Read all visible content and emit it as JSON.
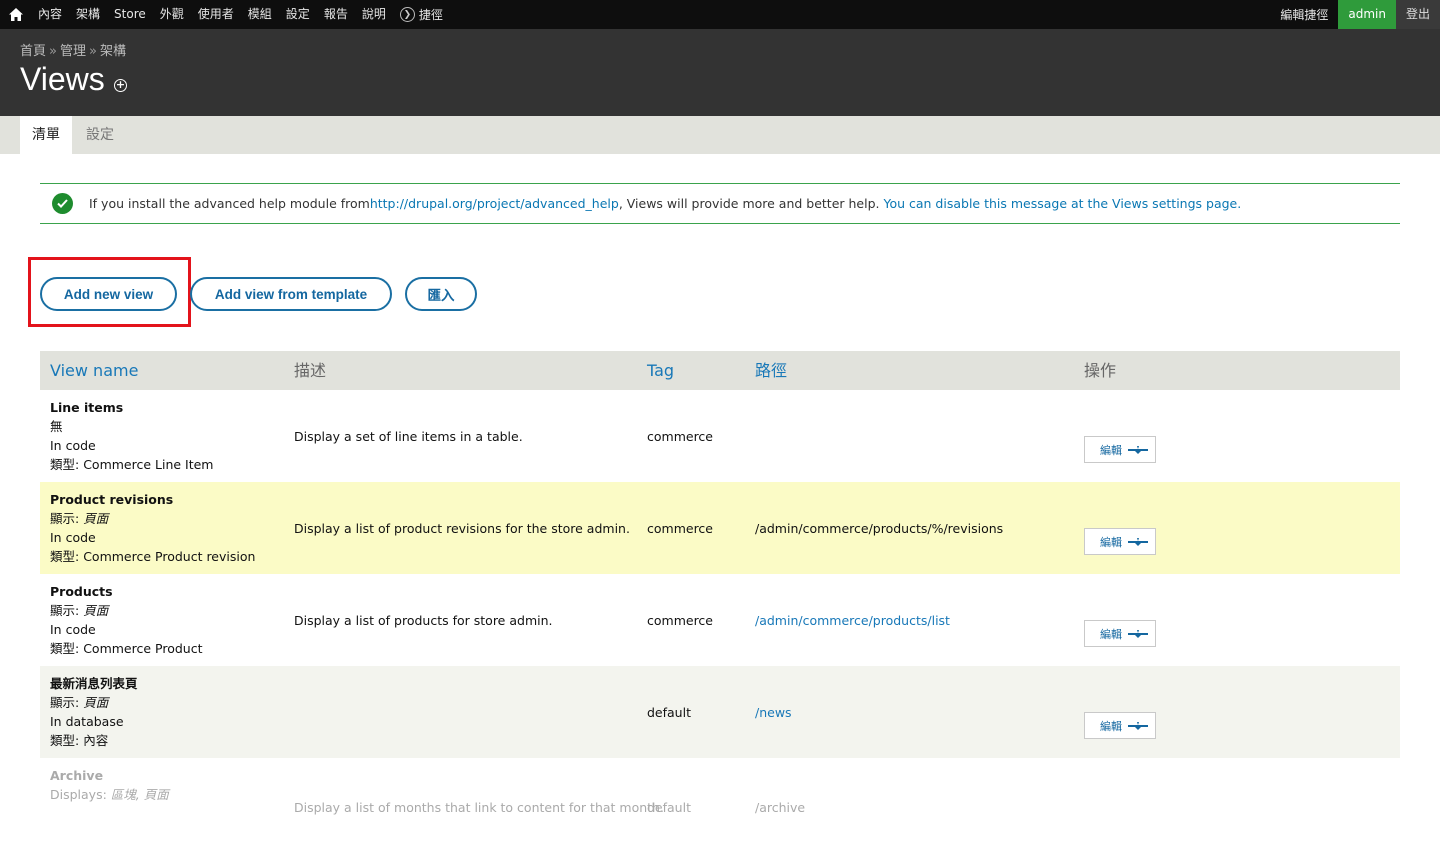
{
  "toolbar": {
    "menu": [
      "內容",
      "架構",
      "Store",
      "外觀",
      "使用者",
      "模組",
      "設定",
      "報告",
      "說明"
    ],
    "shortcuts": "捷徑",
    "edit_shortcuts": "編輯捷徑",
    "user": "admin",
    "logout": "登出"
  },
  "header": {
    "breadcrumb": [
      "首頁",
      "管理",
      "架構"
    ],
    "breadcrumb_sep": "»",
    "title": "Views"
  },
  "tabs": [
    "清單",
    "設定"
  ],
  "message": {
    "text_1": "If you install the advanced help module from ",
    "link_1": "http://drupal.org/project/advanced_help",
    "text_2": ", Views will provide more and better help. ",
    "link_2": "You can disable this message at the Views settings page."
  },
  "buttons": {
    "add_new_view": "Add new view",
    "add_from_template": "Add view from template",
    "import": "匯入"
  },
  "table": {
    "headers": {
      "name": "View name",
      "description": "描述",
      "tag": "Tag",
      "path": "路徑",
      "operations": "操作"
    },
    "edit_label": "編輯",
    "rows": [
      {
        "name": "Line items",
        "display_label": "",
        "display_value": "無",
        "storage": "In code",
        "type_label": "類型: ",
        "type_value": "Commerce Line Item",
        "description": "Display a set of line items in a table.",
        "tag": "commerce",
        "path": ""
      },
      {
        "name": "Product revisions",
        "display_label": "顯示: ",
        "display_value": "頁面",
        "storage": "In code",
        "type_label": "類型: ",
        "type_value": "Commerce Product revision",
        "description": "Display a list of product revisions for the store admin.",
        "tag": "commerce",
        "path": "/admin/commerce/products/%/revisions"
      },
      {
        "name": "Products",
        "display_label": "顯示: ",
        "display_value": "頁面",
        "storage": "In code",
        "type_label": "類型: ",
        "type_value": "Commerce Product",
        "description": "Display a list of products for store admin.",
        "tag": "commerce",
        "path": "/admin/commerce/products/list"
      },
      {
        "name": "最新消息列表頁",
        "display_label": "顯示: ",
        "display_value": "頁面",
        "storage": "In database",
        "type_label": "類型: ",
        "type_value": "內容",
        "description": "",
        "tag": "default",
        "path": "/news"
      },
      {
        "name": "Archive",
        "display_label": "Displays: ",
        "display_value": "區塊, 頁面",
        "storage": "",
        "type_label": "",
        "type_value": "",
        "description": "Display a list of months that link to content for that month.",
        "tag": "default",
        "path": "/archive"
      }
    ]
  },
  "colors": {
    "toolbar_bg": "#0e0e0e",
    "header_bg": "#333333",
    "accent": "#1878b8",
    "admin_green": "#2f9b3b",
    "highlight_red": "#e3131b",
    "row_highlight": "#fbfbc6"
  }
}
